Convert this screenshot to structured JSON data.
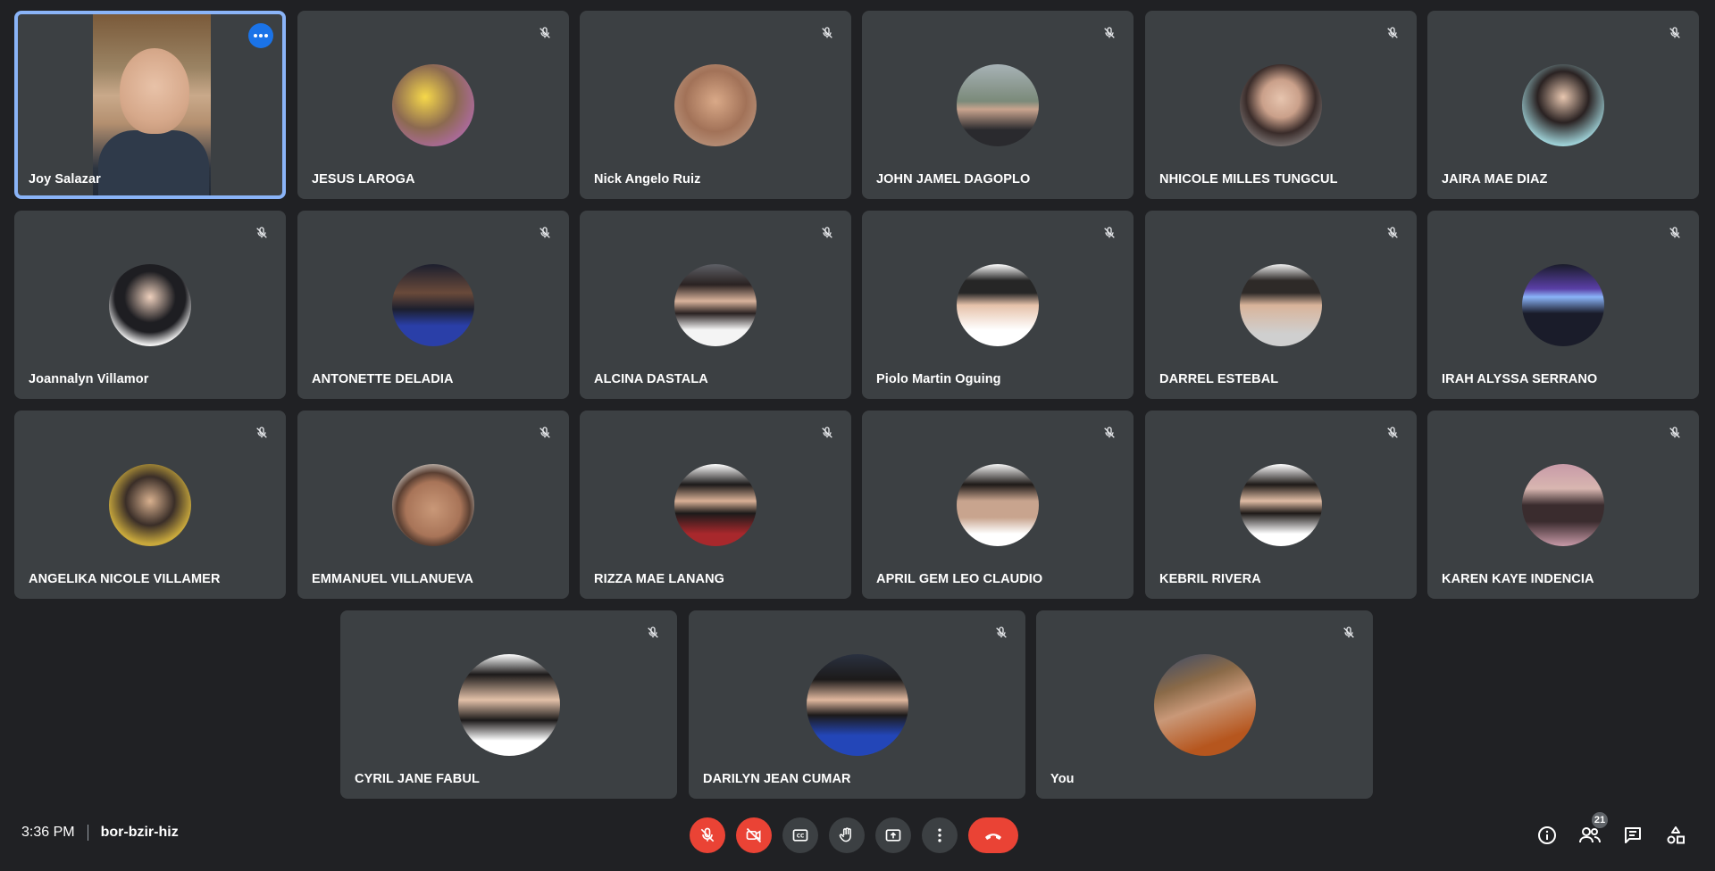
{
  "participants": [
    {
      "name": "Joy Salazar",
      "active": true,
      "has_video": true
    },
    {
      "name": "JESUS LAROGA",
      "muted": true,
      "avatar_colors": [
        "#f6d84a",
        "#c46ad6"
      ]
    },
    {
      "name": "Nick Angelo Ruiz",
      "muted": true,
      "avatar_colors": [
        "#c8a892",
        "#7c5a48"
      ]
    },
    {
      "name": "JOHN JAMEL DAGOPLO",
      "muted": true,
      "avatar_colors": [
        "#a7b2b6",
        "#3b3f44"
      ]
    },
    {
      "name": "NHICOLE MILLES TUNGCUL",
      "muted": true,
      "avatar_colors": [
        "#b8b8b8",
        "#3a2c2a"
      ]
    },
    {
      "name": "JAIRA MAE DIAZ",
      "muted": true,
      "avatar_colors": [
        "#d6d6d6",
        "#9fd2d8"
      ]
    },
    {
      "name": "Joannalyn Villamor",
      "muted": true,
      "avatar_colors": [
        "#f2f2f2",
        "#1e1e22"
      ]
    },
    {
      "name": "ANTONETTE DELADIA",
      "muted": true,
      "avatar_colors": [
        "#1c1f2e",
        "#2a3fa8"
      ]
    },
    {
      "name": "ALCINA DASTALA",
      "muted": true,
      "avatar_colors": [
        "#5e6066",
        "#f4f4f4"
      ]
    },
    {
      "name": "Piolo Martin Oguing",
      "muted": true,
      "avatar_colors": [
        "#ffffff",
        "#262626"
      ]
    },
    {
      "name": "DARREL ESTEBAL",
      "muted": true,
      "avatar_colors": [
        "#f0f0f0",
        "#2e2a28"
      ]
    },
    {
      "name": "IRAH ALYSSA SERRANO",
      "muted": true,
      "avatar_colors": [
        "#5a3fa6",
        "#1a1c2a"
      ]
    },
    {
      "name": "ANGELIKA NICOLE VILLAMER",
      "muted": true,
      "avatar_colors": [
        "#c8a83c",
        "#3a2e28"
      ]
    },
    {
      "name": "EMMANUEL VILLANUEVA",
      "muted": true,
      "avatar_colors": [
        "#d8d2cc",
        "#5a3f32"
      ]
    },
    {
      "name": "RIZZA MAE LANANG",
      "muted": true,
      "avatar_colors": [
        "#ffffff",
        "#a8282c"
      ]
    },
    {
      "name": "APRIL GEM LEO CLAUDIO",
      "muted": true,
      "avatar_colors": [
        "#f4f4f4",
        "#c8a48e"
      ]
    },
    {
      "name": "KEBRIL RIVERA",
      "muted": true,
      "avatar_colors": [
        "#ffffff",
        "#1e1a18"
      ]
    },
    {
      "name": "KAREN KAYE INDENCIA",
      "muted": true,
      "avatar_colors": [
        "#c89aa8",
        "#3a2c2e"
      ]
    },
    {
      "name": "CYRIL JANE FABUL",
      "muted": true,
      "avatar_colors": [
        "#ffffff",
        "#1c1a1a"
      ]
    },
    {
      "name": "DARILYN JEAN CUMAR",
      "muted": true,
      "avatar_colors": [
        "#2a3140",
        "#2346b8"
      ]
    },
    {
      "name": "You",
      "muted": true,
      "avatar_colors": [
        "#8a6a48",
        "#b6561e"
      ]
    }
  ],
  "footer": {
    "time": "3:36 PM",
    "meeting_code": "bor-bzir-hiz",
    "participant_count": "21"
  },
  "controls": {
    "mic": "mic-off-icon",
    "camera": "camera-off-icon",
    "captions": "captions-icon",
    "raise_hand": "hand-icon",
    "present": "present-icon",
    "more": "more-vert-icon",
    "leave": "call-end-icon"
  },
  "colors": {
    "background": "#202124",
    "tile": "#3c4043",
    "active_border": "#8ab4f8",
    "red": "#ea4335",
    "accent": "#1a73e8"
  }
}
